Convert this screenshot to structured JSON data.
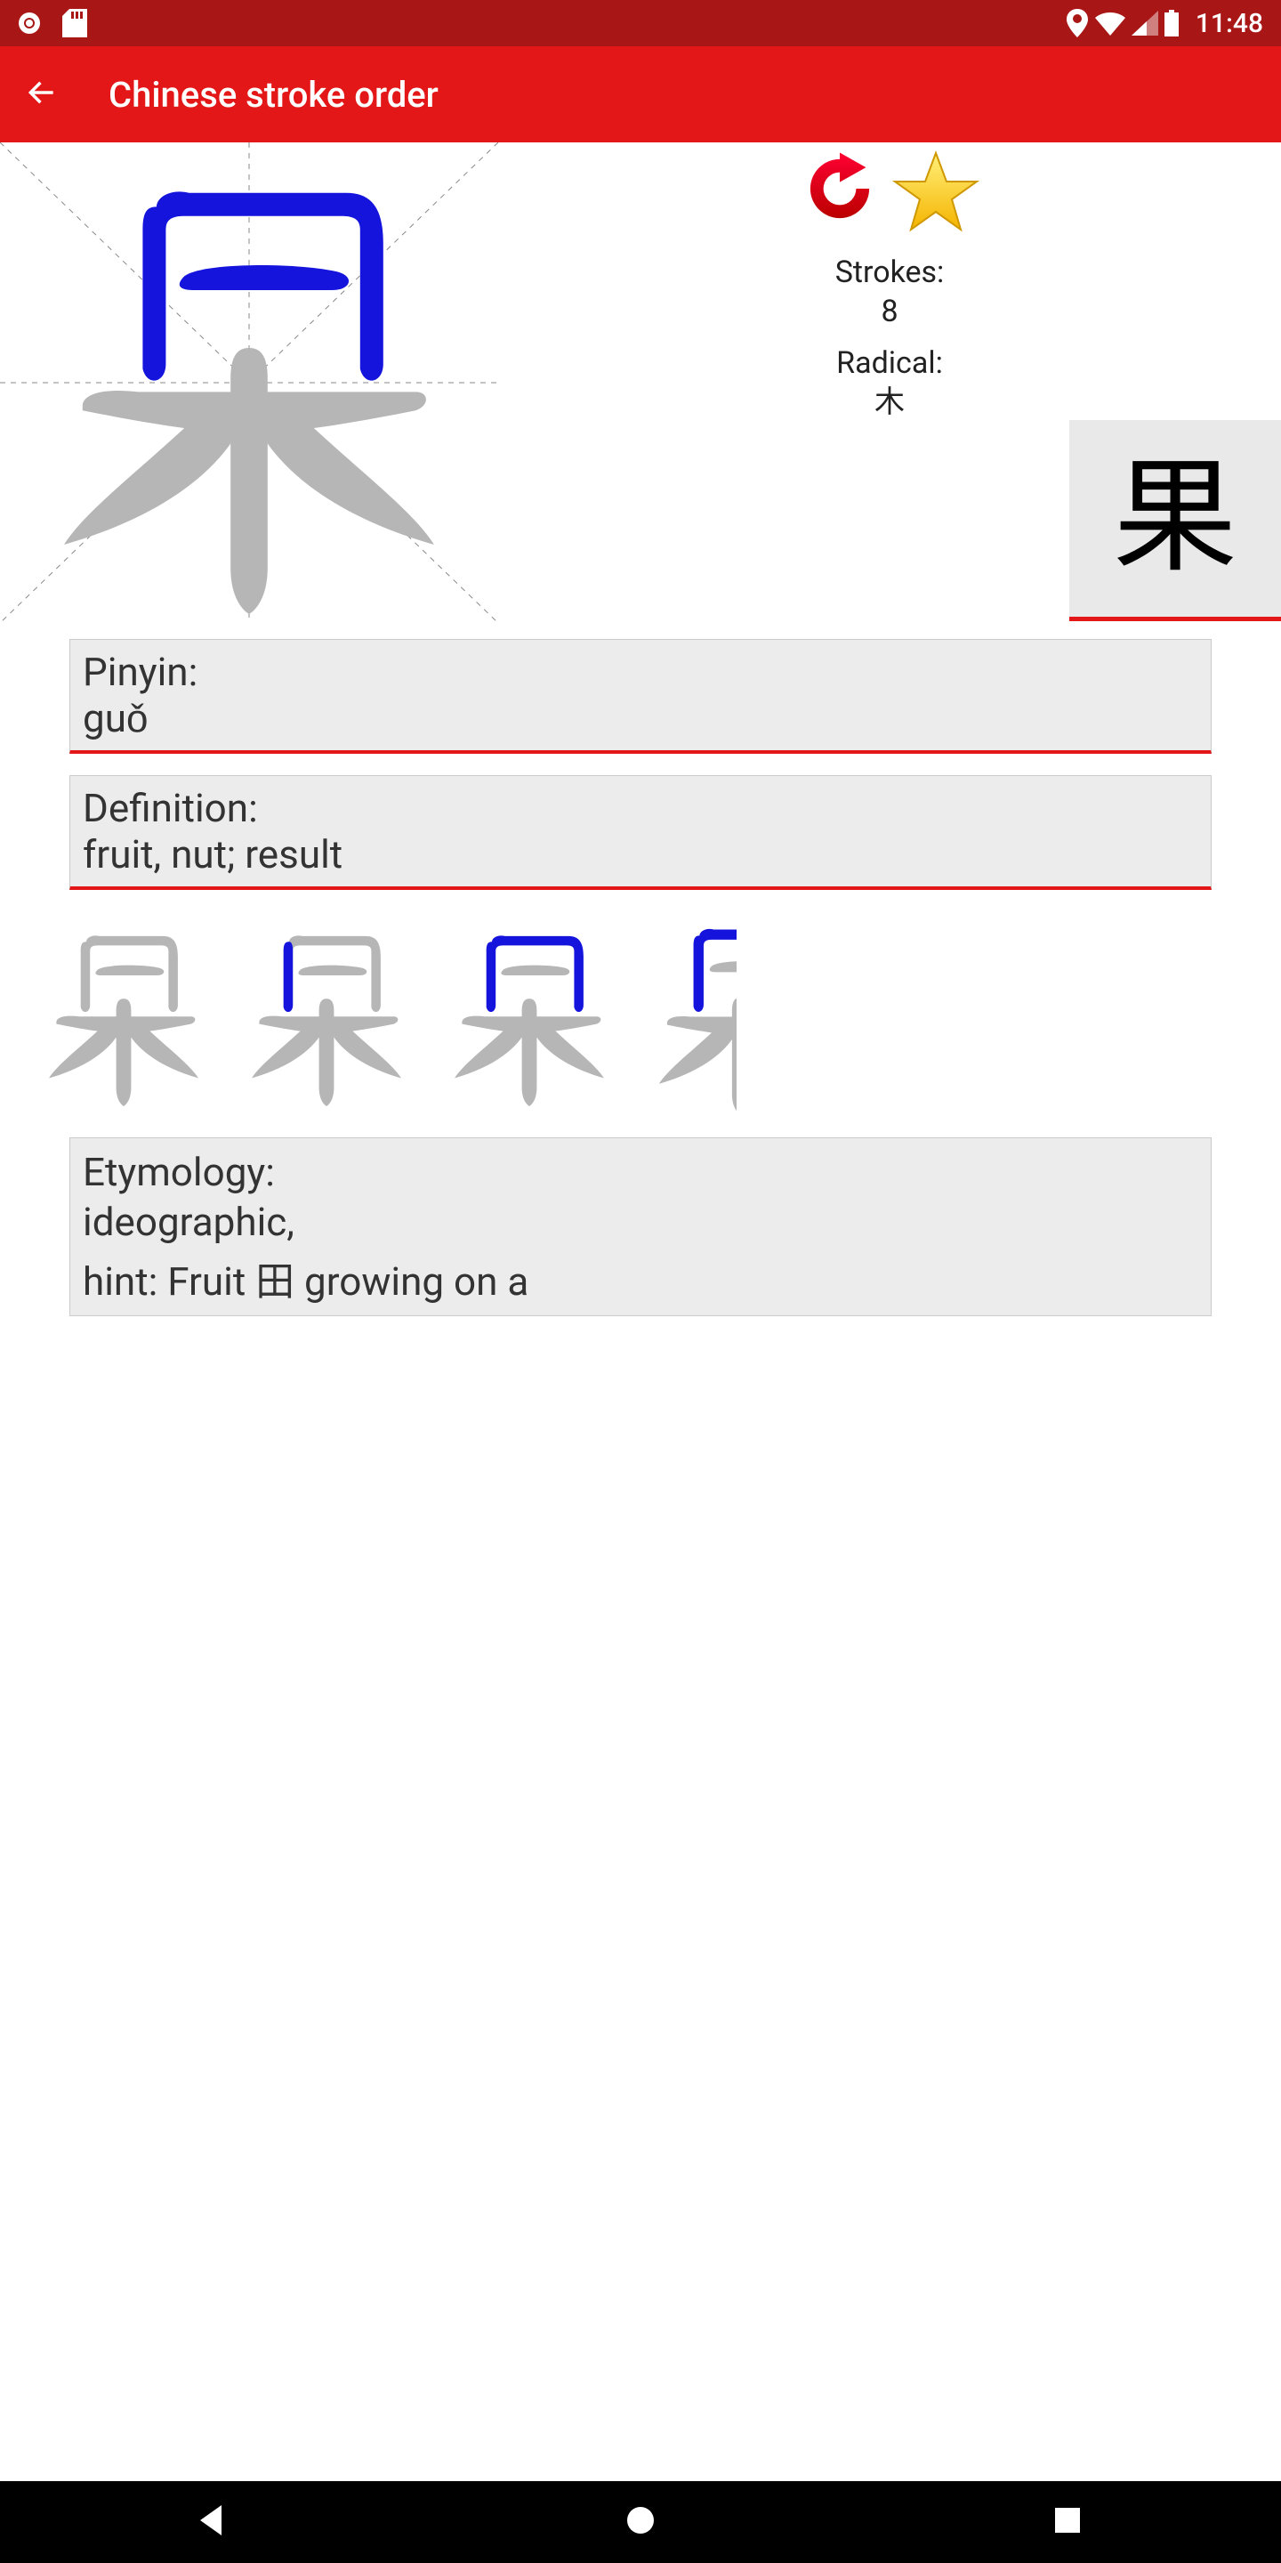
{
  "status": {
    "time": "11:48"
  },
  "app": {
    "title": "Chinese stroke order"
  },
  "character": {
    "glyph": "果",
    "strokes_label": "Strokes:",
    "strokes": "8",
    "radical_label": "Radical:",
    "radical": "木",
    "pinyin_label": "Pinyin:",
    "pinyin": "guǒ",
    "definition_label": "Definition:",
    "definition": "fruit, nut; result",
    "etymology_label": "Etymology:",
    "etymology_type": "ideographic,",
    "etymology_hint": "hint: Fruit 田 growing on a"
  },
  "colors": {
    "accent": "#e31717",
    "accent_dark": "#a91616",
    "drawn": "#1414dd",
    "undrawn": "#b6b6b6"
  }
}
